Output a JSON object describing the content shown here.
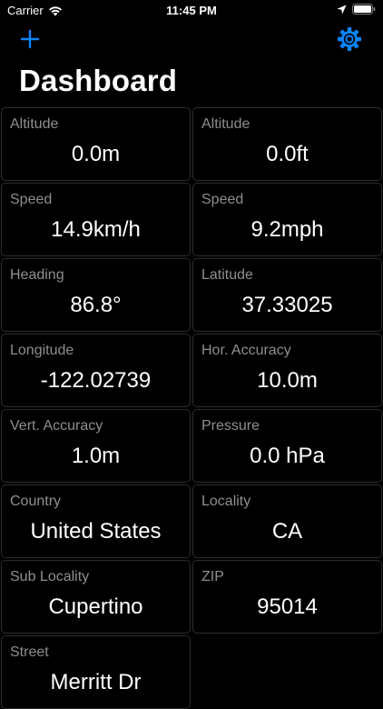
{
  "status_bar": {
    "carrier": "Carrier",
    "time": "11:45 PM"
  },
  "toolbar": {
    "add_icon": "plus-icon",
    "settings_icon": "gear-icon",
    "accent_color": "#0a84ff"
  },
  "page": {
    "title": "Dashboard"
  },
  "tiles": [
    {
      "label": "Altitude",
      "value": "0.0m"
    },
    {
      "label": "Altitude",
      "value": "0.0ft"
    },
    {
      "label": "Speed",
      "value": "14.9km/h"
    },
    {
      "label": "Speed",
      "value": "9.2mph"
    },
    {
      "label": "Heading",
      "value": "86.8°"
    },
    {
      "label": "Latitude",
      "value": "37.33025"
    },
    {
      "label": "Longitude",
      "value": "-122.02739"
    },
    {
      "label": "Hor. Accuracy",
      "value": "10.0m"
    },
    {
      "label": "Vert. Accuracy",
      "value": "1.0m"
    },
    {
      "label": "Pressure",
      "value": "0.0 hPa"
    },
    {
      "label": "Country",
      "value": "United States"
    },
    {
      "label": "Locality",
      "value": "CA"
    },
    {
      "label": "Sub Locality",
      "value": "Cupertino"
    },
    {
      "label": "ZIP",
      "value": "95014"
    },
    {
      "label": "Street",
      "value": "Merritt Dr"
    }
  ]
}
